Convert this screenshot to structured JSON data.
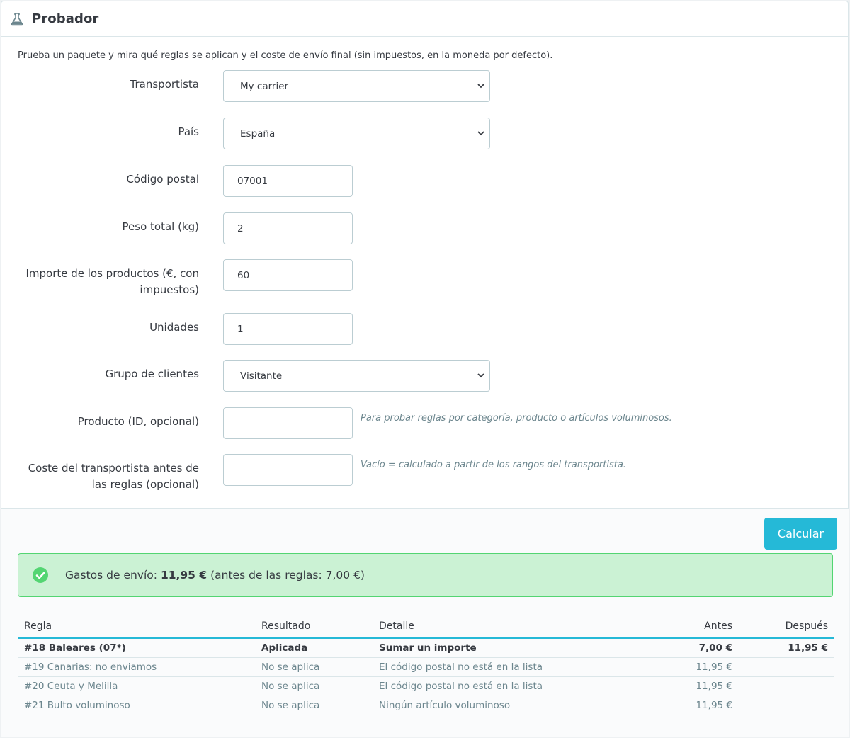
{
  "panel": {
    "title": "Probador",
    "icon": "flask-icon"
  },
  "intro": "Prueba un paquete y mira qué reglas se aplican y el coste de envío final (sin impuestos, en la moneda por defecto).",
  "form": {
    "carrier": {
      "label": "Transportista",
      "value": "My carrier"
    },
    "country": {
      "label": "País",
      "value": "España"
    },
    "postcode": {
      "label": "Código postal",
      "value": "07001"
    },
    "weight": {
      "label": "Peso total (kg)",
      "value": "2"
    },
    "amount": {
      "label_line1": "Importe de los productos (€, con",
      "label_line2": "impuestos)",
      "value": "60"
    },
    "units": {
      "label": "Unidades",
      "value": "1"
    },
    "group": {
      "label": "Grupo de clientes",
      "value": "Visitante"
    },
    "product": {
      "label": "Producto (ID, opcional)",
      "value": "",
      "help": "Para probar reglas por categoría, producto o artículos voluminosos."
    },
    "base_cost": {
      "label_line1": "Coste del transportista antes de",
      "label_line2": "las reglas (opcional)",
      "value": "",
      "help": "Vacío = calculado a partir de los rangos del transportista."
    }
  },
  "actions": {
    "calculate_label": "Calcular"
  },
  "result": {
    "prefix": "Gastos de envío:",
    "total": "11,95 €",
    "suffix": "(antes de las reglas: 7,00 €)",
    "status_color": "#53d572"
  },
  "table": {
    "headers": {
      "rule": "Regla",
      "result": "Resultado",
      "detail": "Detalle",
      "before": "Antes",
      "after": "Después"
    },
    "rows": [
      {
        "rule": "#18 Baleares (07*)",
        "result": "Aplicada",
        "detail": "Sumar un importe",
        "before": "7,00 €",
        "after": "11,95 €"
      },
      {
        "rule": "#19 Canarias: no enviamos",
        "result": "No se aplica",
        "detail": "El código postal no está en la lista",
        "before": "11,95 €",
        "after": ""
      },
      {
        "rule": "#20 Ceuta y Melilla",
        "result": "No se aplica",
        "detail": "El código postal no está en la lista",
        "before": "11,95 €",
        "after": ""
      },
      {
        "rule": "#21 Bulto voluminoso",
        "result": "No se aplica",
        "detail": "Ningún artículo voluminoso",
        "before": "11,95 €",
        "after": ""
      }
    ]
  },
  "colors": {
    "accent": "#25b9d7",
    "success_bg": "#cbf2d4",
    "success_border": "#53d572"
  }
}
